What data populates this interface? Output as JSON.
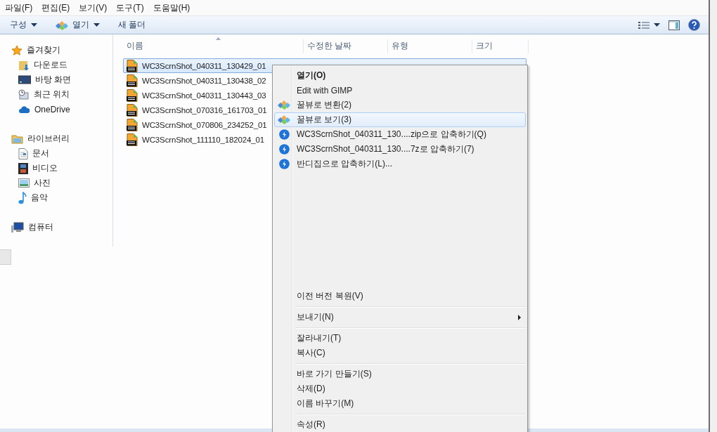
{
  "menu_bar": [
    {
      "label": "파일(F)"
    },
    {
      "label": "편집(E)"
    },
    {
      "label": "보기(V)"
    },
    {
      "label": "도구(T)"
    },
    {
      "label": "도움말(H)"
    }
  ],
  "toolbar": {
    "organize": "구성",
    "open": "열기",
    "new_folder": "새 폴더"
  },
  "sidebar": {
    "groups": [
      {
        "label": "즐겨찾기",
        "children": [
          {
            "label": "다운로드"
          },
          {
            "label": "바탕 화면"
          },
          {
            "label": "최근 위치"
          },
          {
            "label": "OneDrive"
          }
        ]
      },
      {
        "label": "라이브러리",
        "children": [
          {
            "label": "문서"
          },
          {
            "label": "비디오"
          },
          {
            "label": "사진"
          },
          {
            "label": "음악"
          }
        ]
      },
      {
        "label": "컴퓨터"
      }
    ]
  },
  "file_list": {
    "columns": [
      "이름",
      "수정한 날짜",
      "유형",
      "크기"
    ],
    "rows": [
      {
        "name": "WC3ScrnShot_040311_130429_01",
        "selected": true
      },
      {
        "name": "WC3ScrnShot_040311_130438_02",
        "selected": false
      },
      {
        "name": "WC3ScrnShot_040311_130443_03",
        "selected": false
      },
      {
        "name": "WC3ScrnShot_070316_161703_01",
        "selected": false
      },
      {
        "name": "WC3ScrnShot_070806_234252_01",
        "selected": false
      },
      {
        "name": "WC3ScrnShot_111110_182024_01",
        "selected": false
      }
    ]
  },
  "context_menu": {
    "top_items": [
      {
        "kind": "item",
        "label": "열기(O)",
        "default": true,
        "selected": false
      },
      {
        "kind": "item",
        "label": "Edit with GIMP",
        "default": false,
        "selected": false
      },
      {
        "kind": "viewer",
        "label": "꿀뷰로 변환(2)",
        "default": false,
        "selected": false
      },
      {
        "kind": "viewer",
        "label": "꿀뷰로 보기(3)",
        "default": false,
        "selected": true
      },
      {
        "kind": "archive",
        "label": "WC3ScrnShot_040311_130....zip으로 압축하기(Q)",
        "default": false,
        "selected": false
      },
      {
        "kind": "archive",
        "label": "WC3ScrnShot_040311_130....7z로 압축하기(7)",
        "default": false,
        "selected": false
      },
      {
        "kind": "archive",
        "label": "반디집으로 압축하기(L)...",
        "default": false,
        "selected": false
      }
    ],
    "bottom_items": [
      {
        "kind": "item",
        "label": "이전 버전 복원(V)",
        "default": false,
        "selected": false
      },
      {
        "kind": "separator"
      },
      {
        "kind": "submenu",
        "label": "보내기(N)",
        "default": false,
        "selected": false
      },
      {
        "kind": "separator"
      },
      {
        "kind": "item",
        "label": "잘라내기(T)",
        "default": false,
        "selected": false
      },
      {
        "kind": "item",
        "label": "복사(C)",
        "default": false,
        "selected": false
      },
      {
        "kind": "separator"
      },
      {
        "kind": "item",
        "label": "바로 가기 만들기(S)",
        "default": false,
        "selected": false
      },
      {
        "kind": "item",
        "label": "삭제(D)",
        "default": false,
        "selected": false
      },
      {
        "kind": "item",
        "label": "이름 바꾸기(M)",
        "default": false,
        "selected": false
      },
      {
        "kind": "separator"
      },
      {
        "kind": "item",
        "label": "속성(R)",
        "default": false,
        "selected": false
      }
    ]
  }
}
